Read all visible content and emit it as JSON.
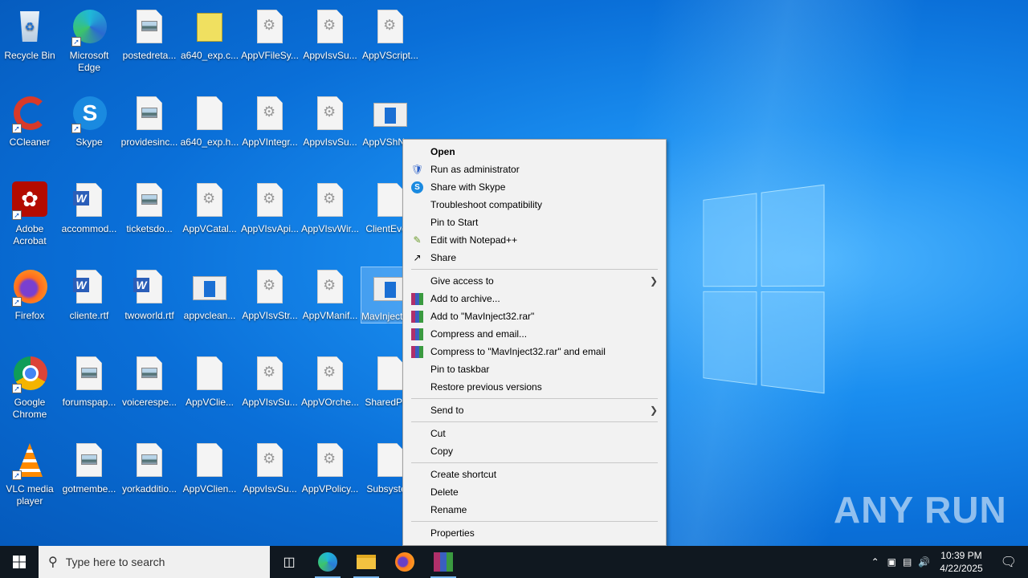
{
  "desktop": {
    "icons": [
      {
        "label": "Recycle Bin",
        "type": "recycle"
      },
      {
        "label": "Microsoft Edge",
        "type": "edge",
        "shortcut": true
      },
      {
        "label": "postedreta...",
        "type": "image"
      },
      {
        "label": "a640_exp.c...",
        "type": "cabinet"
      },
      {
        "label": "AppVFileSy...",
        "type": "gear"
      },
      {
        "label": "AppvIsvSu...",
        "type": "gear"
      },
      {
        "label": "AppVScript...",
        "type": "gear"
      },
      {
        "label": "CCleaner",
        "type": "ccleaner",
        "shortcut": true
      },
      {
        "label": "Skype",
        "type": "skype",
        "shortcut": true
      },
      {
        "label": "providesinc...",
        "type": "image"
      },
      {
        "label": "a640_exp.h...",
        "type": "blank"
      },
      {
        "label": "AppVIntegr...",
        "type": "gear"
      },
      {
        "label": "AppvIsvSu...",
        "type": "gear"
      },
      {
        "label": "AppVShNo...",
        "type": "window"
      },
      {
        "label": "Adobe Acrobat",
        "type": "acrobat",
        "shortcut": true
      },
      {
        "label": "accommod...",
        "type": "word"
      },
      {
        "label": "ticketsdo...",
        "type": "image"
      },
      {
        "label": "AppVCatal...",
        "type": "gear"
      },
      {
        "label": "AppVIsvApi...",
        "type": "gear"
      },
      {
        "label": "AppVIsvWir...",
        "type": "gear"
      },
      {
        "label": "ClientEve...",
        "type": "blank"
      },
      {
        "label": "Firefox",
        "type": "firefox",
        "shortcut": true
      },
      {
        "label": "cliente.rtf",
        "type": "word"
      },
      {
        "label": "twoworld.rtf",
        "type": "word"
      },
      {
        "label": "appvclean...",
        "type": "window"
      },
      {
        "label": "AppVIsvStr...",
        "type": "gear"
      },
      {
        "label": "AppVManif...",
        "type": "gear"
      },
      {
        "label": "MavInject32.exe",
        "type": "window",
        "selected": true
      },
      {
        "label": "Google Chrome",
        "type": "chrome",
        "shortcut": true
      },
      {
        "label": "forumspap...",
        "type": "image"
      },
      {
        "label": "voicerespe...",
        "type": "image"
      },
      {
        "label": "AppVClie...",
        "type": "blank"
      },
      {
        "label": "AppVIsvSu...",
        "type": "gear"
      },
      {
        "label": "AppVOrche...",
        "type": "gear"
      },
      {
        "label": "SharedPe...",
        "type": "blank"
      },
      {
        "label": "VLC media player",
        "type": "vlc",
        "shortcut": true
      },
      {
        "label": "gotmembe...",
        "type": "image"
      },
      {
        "label": "yorkadditio...",
        "type": "image"
      },
      {
        "label": "AppVClien...",
        "type": "blank"
      },
      {
        "label": "AppvIsvSu...",
        "type": "gear"
      },
      {
        "label": "AppVPolicy...",
        "type": "gear"
      },
      {
        "label": "Subsyste...",
        "type": "blank"
      }
    ]
  },
  "context_menu": {
    "groups": [
      [
        {
          "label": "Open",
          "bold": true
        },
        {
          "label": "Run as administrator",
          "icon": "shield-icon"
        },
        {
          "label": "Share with Skype",
          "icon": "skype-icon"
        },
        {
          "label": "Troubleshoot compatibility"
        },
        {
          "label": "Pin to Start"
        },
        {
          "label": "Edit with Notepad++",
          "icon": "notepadpp-icon"
        },
        {
          "label": "Share",
          "icon": "share-icon"
        }
      ],
      [
        {
          "label": "Give access to",
          "submenu": true
        },
        {
          "label": "Add to archive...",
          "icon": "winrar-icon"
        },
        {
          "label": "Add to \"MavInject32.rar\"",
          "icon": "winrar-icon"
        },
        {
          "label": "Compress and email...",
          "icon": "winrar-icon"
        },
        {
          "label": "Compress to \"MavInject32.rar\" and email",
          "icon": "winrar-icon"
        },
        {
          "label": "Pin to taskbar"
        },
        {
          "label": "Restore previous versions"
        }
      ],
      [
        {
          "label": "Send to",
          "submenu": true
        }
      ],
      [
        {
          "label": "Cut"
        },
        {
          "label": "Copy"
        }
      ],
      [
        {
          "label": "Create shortcut"
        },
        {
          "label": "Delete"
        },
        {
          "label": "Rename"
        }
      ],
      [
        {
          "label": "Properties"
        }
      ]
    ]
  },
  "taskbar": {
    "search_placeholder": "Type here to search",
    "time": "10:39 PM",
    "date": "4/22/2025",
    "apps": [
      "task-view",
      "edge",
      "file-explorer",
      "firefox",
      "winrar"
    ]
  },
  "watermark": "ANY RUN"
}
